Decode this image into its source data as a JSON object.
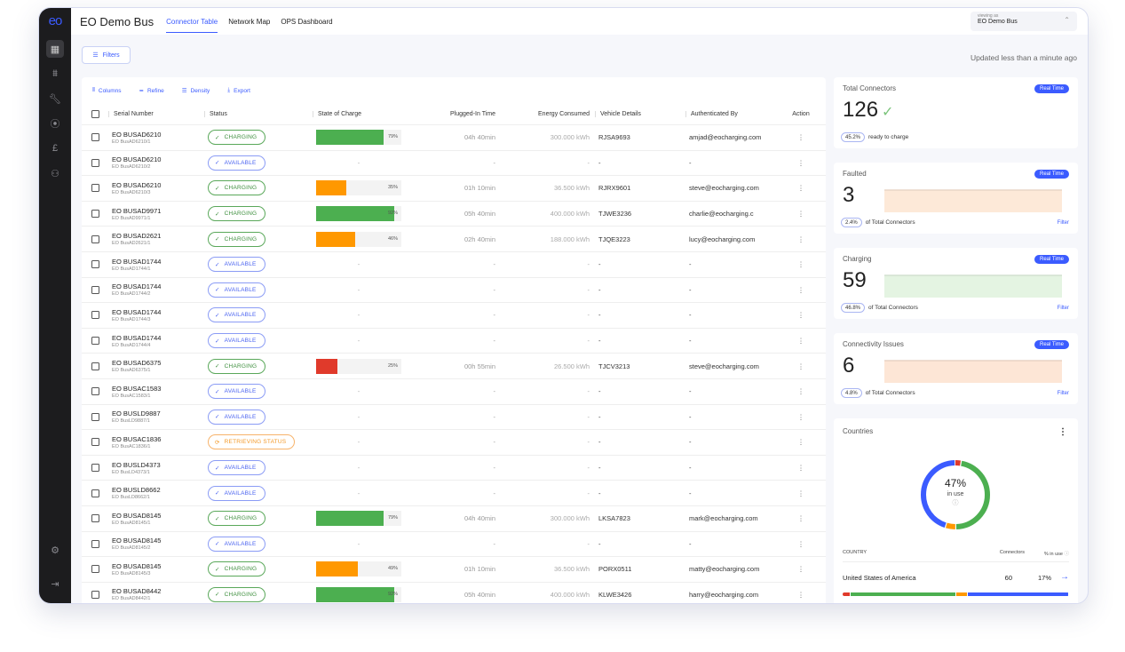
{
  "app": {
    "logo": "eo",
    "title": "EO Demo Bus"
  },
  "tabs": [
    {
      "label": "Connector Table",
      "active": true
    },
    {
      "label": "Network Map",
      "active": false
    },
    {
      "label": "OPS Dashboard",
      "active": false
    }
  ],
  "sidebar": {
    "items": [
      {
        "name": "dashboard-icon",
        "glyph": "▦",
        "active": true
      },
      {
        "name": "analytics-icon",
        "glyph": "⩩",
        "active": false
      },
      {
        "name": "wrench-icon",
        "glyph": "🔧︎",
        "active": false
      },
      {
        "name": "signal-icon",
        "glyph": "⦿",
        "active": false
      },
      {
        "name": "pound-icon",
        "glyph": "£",
        "active": false
      },
      {
        "name": "users-icon",
        "glyph": "⚇",
        "active": false
      }
    ],
    "bottom": [
      {
        "name": "settings-icon",
        "glyph": "⚙"
      },
      {
        "name": "logout-icon",
        "glyph": "⇥"
      }
    ]
  },
  "viewing": {
    "label": "viewing as",
    "value": "EO Demo Bus"
  },
  "filters_label": "Filters",
  "updated_text": "Updated less than a minute ago",
  "toolbar": {
    "columns": "Columns",
    "refine": "Refine",
    "density": "Density",
    "export": "Export"
  },
  "table": {
    "headers": {
      "serial": "Serial Number",
      "status": "Status",
      "soc": "State of Charge",
      "plugged": "Plugged-In Time",
      "energy": "Energy Consumed",
      "vehicle": "Vehicle Details",
      "auth": "Authenticated By",
      "action": "Action"
    },
    "rows": [
      {
        "serial": "EO BUSAD6210",
        "sub": "EO BusAD6210/1",
        "status": "CHARGING",
        "soc": 79,
        "plugged": "04h 40min",
        "energy": "300.000 kWh",
        "vehicle": "RJSA9693",
        "auth": "amjad@eocharging.com"
      },
      {
        "serial": "EO BUSAD6210",
        "sub": "EO BusAD6210/2",
        "status": "AVAILABLE",
        "soc": null,
        "plugged": "-",
        "energy": "-",
        "vehicle": "-",
        "auth": "-"
      },
      {
        "serial": "EO BUSAD6210",
        "sub": "EO BusAD6210/3",
        "status": "CHARGING",
        "soc": 35,
        "plugged": "01h 10min",
        "energy": "36.500 kWh",
        "vehicle": "RJRX9601",
        "auth": "steve@eocharging.com"
      },
      {
        "serial": "EO BUSAD9971",
        "sub": "EO BusAD9971/1",
        "status": "CHARGING",
        "soc": 92,
        "plugged": "05h 40min",
        "energy": "400.000 kWh",
        "vehicle": "TJWE3236",
        "auth": "charlie@eocharging.c"
      },
      {
        "serial": "EO BUSAD2621",
        "sub": "EO BusAD2621/1",
        "status": "CHARGING",
        "soc": 46,
        "plugged": "02h 40min",
        "energy": "188.000 kWh",
        "vehicle": "TJQE3223",
        "auth": "lucy@eocharging.com"
      },
      {
        "serial": "EO BUSAD1744",
        "sub": "EO BusAD1744/1",
        "status": "AVAILABLE",
        "soc": null,
        "plugged": "-",
        "energy": "-",
        "vehicle": "-",
        "auth": "-"
      },
      {
        "serial": "EO BUSAD1744",
        "sub": "EO BusAD1744/2",
        "status": "AVAILABLE",
        "soc": null,
        "plugged": "-",
        "energy": "-",
        "vehicle": "-",
        "auth": "-"
      },
      {
        "serial": "EO BUSAD1744",
        "sub": "EO BusAD1744/3",
        "status": "AVAILABLE",
        "soc": null,
        "plugged": "-",
        "energy": "-",
        "vehicle": "-",
        "auth": "-"
      },
      {
        "serial": "EO BUSAD1744",
        "sub": "EO BusAD1744/4",
        "status": "AVAILABLE",
        "soc": null,
        "plugged": "-",
        "energy": "-",
        "vehicle": "-",
        "auth": "-"
      },
      {
        "serial": "EO BUSAD6375",
        "sub": "EO BusAD6375/1",
        "status": "CHARGING",
        "soc": 25,
        "plugged": "00h 55min",
        "energy": "26.500 kWh",
        "vehicle": "TJCV3213",
        "auth": "steve@eocharging.com"
      },
      {
        "serial": "EO BUSAC1583",
        "sub": "EO BusAC1583/1",
        "status": "AVAILABLE",
        "soc": null,
        "plugged": "-",
        "energy": "-",
        "vehicle": "-",
        "auth": "-"
      },
      {
        "serial": "EO BUSLD9887",
        "sub": "EO BusLD9887/1",
        "status": "AVAILABLE",
        "soc": null,
        "plugged": "-",
        "energy": "-",
        "vehicle": "-",
        "auth": "-"
      },
      {
        "serial": "EO BUSAC1836",
        "sub": "EO BusAC1836/1",
        "status": "RETRIEVING STATUS",
        "soc": null,
        "plugged": "-",
        "energy": "-",
        "vehicle": "-",
        "auth": "-"
      },
      {
        "serial": "EO BUSLD4373",
        "sub": "EO BusLD4373/1",
        "status": "AVAILABLE",
        "soc": null,
        "plugged": "-",
        "energy": "-",
        "vehicle": "-",
        "auth": "-"
      },
      {
        "serial": "EO BUSLD8662",
        "sub": "EO BusLD8662/1",
        "status": "AVAILABLE",
        "soc": null,
        "plugged": "-",
        "energy": "-",
        "vehicle": "-",
        "auth": "-"
      },
      {
        "serial": "EO BUSAD8145",
        "sub": "EO BusAD8145/1",
        "status": "CHARGING",
        "soc": 79,
        "plugged": "04h 40min",
        "energy": "300.000 kWh",
        "vehicle": "LKSA7823",
        "auth": "mark@eocharging.com"
      },
      {
        "serial": "EO BUSAD8145",
        "sub": "EO BusAD8145/2",
        "status": "AVAILABLE",
        "soc": null,
        "plugged": "-",
        "energy": "-",
        "vehicle": "-",
        "auth": "-"
      },
      {
        "serial": "EO BUSAD8145",
        "sub": "EO BusAD8145/3",
        "status": "CHARGING",
        "soc": 49,
        "plugged": "01h 10min",
        "energy": "36.500 kWh",
        "vehicle": "PORX0511",
        "auth": "matty@eocharging.com"
      },
      {
        "serial": "EO BUSAD8442",
        "sub": "EO BusAD8442/1",
        "status": "CHARGING",
        "soc": 92,
        "plugged": "05h 40min",
        "energy": "400.000 kWh",
        "vehicle": "KLWE3426",
        "auth": "harry@eocharging.com"
      }
    ]
  },
  "kpis": [
    {
      "title": "Total Connectors",
      "badge": "Real Time",
      "value": "126",
      "pct": "45.2%",
      "caption": "ready to charge",
      "filter": null,
      "spark": null
    },
    {
      "title": "Faulted",
      "badge": "Real Time",
      "value": "3",
      "pct": "2.4%",
      "caption": "of Total Connectors",
      "filter": "Filter",
      "spark": "#fde9d8"
    },
    {
      "title": "Charging",
      "badge": "Real Time",
      "value": "59",
      "pct": "46.8%",
      "caption": "of Total Connectors",
      "filter": "Filter",
      "spark": "#e4f4e2"
    },
    {
      "title": "Connectivity Issues",
      "badge": "Real Time",
      "value": "6",
      "pct": "4.8%",
      "caption": "of Total Connectors",
      "filter": "Filter",
      "spark": "#fde6d6"
    }
  ],
  "countries": {
    "title": "Countries",
    "donut": {
      "center_value": "47%",
      "center_label": "in use",
      "segments": [
        {
          "name": "faulted",
          "pct": 3,
          "color": "#e03a2b"
        },
        {
          "name": "charging",
          "pct": 47,
          "color": "#4caf50"
        },
        {
          "name": "connectivity",
          "pct": 5,
          "color": "#ff9800"
        },
        {
          "name": "available",
          "pct": 45,
          "color": "#3b5bff"
        }
      ]
    },
    "headers": {
      "country": "COUNTRY",
      "connectors": "Connectors",
      "in_use": "% in use"
    },
    "rows": [
      {
        "country": "United States of America",
        "connectors": "60",
        "in_use": "17%"
      }
    ]
  },
  "colors": {
    "accent": "#3b5bff",
    "green": "#4caf50",
    "orange": "#ff9800",
    "red": "#e03a2b"
  }
}
